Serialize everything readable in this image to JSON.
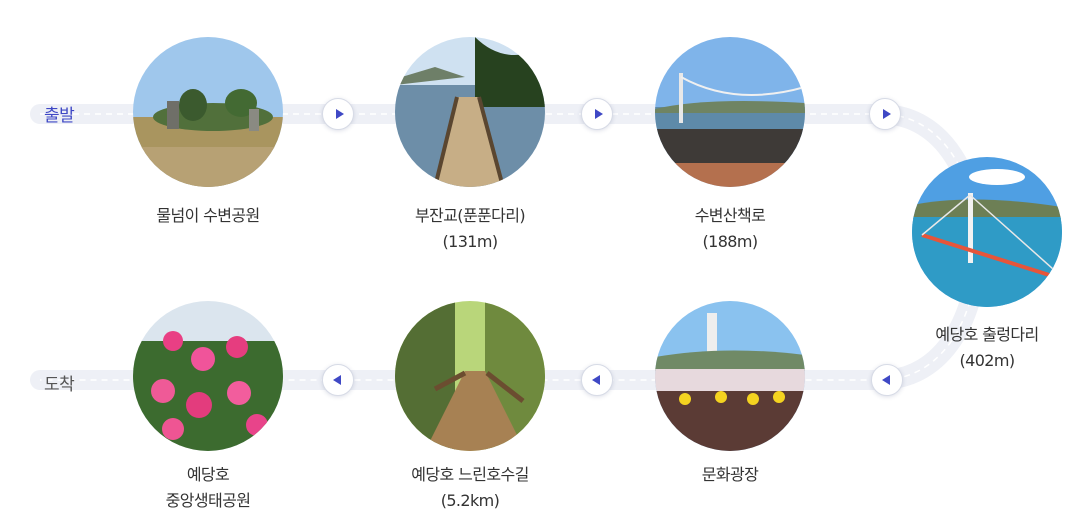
{
  "route": {
    "start_label": "출발",
    "end_label": "도착",
    "accent_color": "#3f48c5"
  },
  "stops": [
    {
      "name": "물넘이 수변공원",
      "distance": "",
      "icon": "park-photo"
    },
    {
      "name": "부잔교(푼푼다리)",
      "distance": "(131m)",
      "icon": "floating-bridge-photo"
    },
    {
      "name": "수변산책로",
      "distance": "(188m)",
      "icon": "waterside-walkway-photo"
    },
    {
      "name": "예당호 출렁다리",
      "distance": "(402m)",
      "icon": "suspension-bridge-photo"
    },
    {
      "name": "문화광장",
      "distance": "",
      "icon": "culture-plaza-photo"
    },
    {
      "name": "예당호 느린호수길",
      "distance": "(5.2km)",
      "icon": "forest-boardwalk-photo"
    },
    {
      "name": "예당호",
      "distance": "중앙생태공원",
      "icon": "flower-park-photo"
    }
  ],
  "arrows": [
    {
      "direction": "right",
      "icon": "arrow-right-icon"
    },
    {
      "direction": "right",
      "icon": "arrow-right-icon"
    },
    {
      "direction": "right",
      "icon": "arrow-right-icon"
    },
    {
      "direction": "left",
      "icon": "arrow-left-icon"
    },
    {
      "direction": "left",
      "icon": "arrow-left-icon"
    },
    {
      "direction": "left",
      "icon": "arrow-left-icon"
    }
  ]
}
